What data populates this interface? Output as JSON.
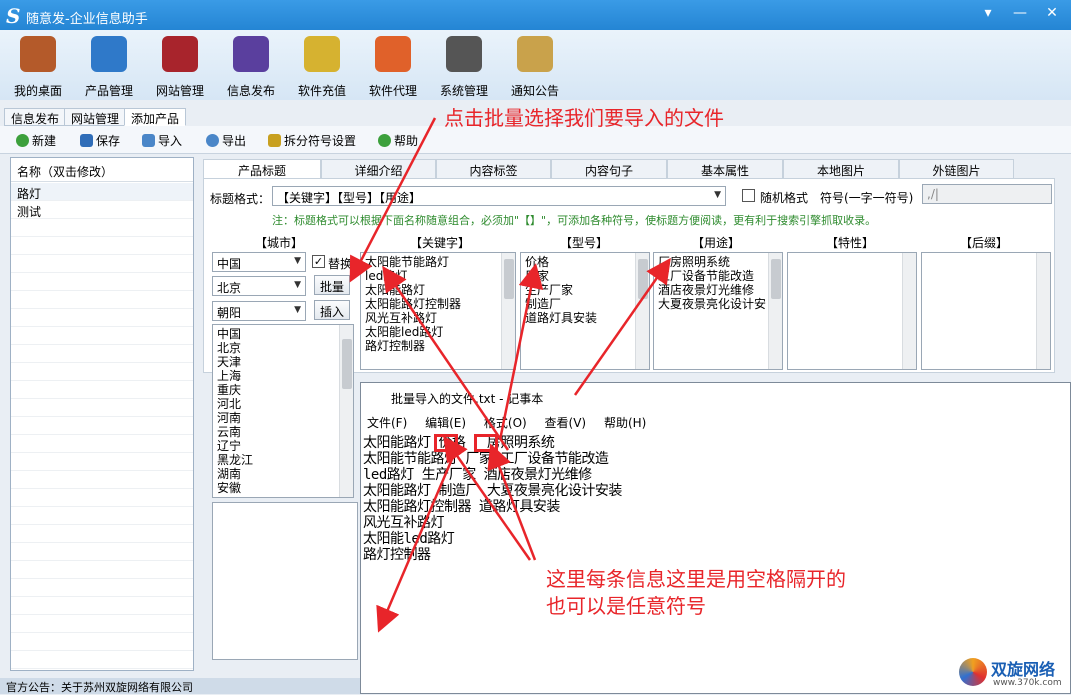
{
  "window": {
    "title": "随意发-企业信息助手",
    "logo": "S",
    "controls": [
      "▾",
      "—",
      "✕"
    ]
  },
  "toolbar": [
    {
      "label": "我的桌面",
      "icon": "house-icon",
      "color": "#b45a2a"
    },
    {
      "label": "产品管理",
      "icon": "cloud-drive-icon",
      "color": "#2f79c9"
    },
    {
      "label": "网站管理",
      "icon": "factory-icon",
      "color": "#a8242c"
    },
    {
      "label": "信息发布",
      "icon": "magic-wand-icon",
      "color": "#5a3f9e"
    },
    {
      "label": "软件充值",
      "icon": "bar-chart-icon",
      "color": "#d6b230"
    },
    {
      "label": "软件代理",
      "icon": "gift-icon",
      "color": "#e0612a"
    },
    {
      "label": "系统管理",
      "icon": "gear-icon",
      "color": "#555555"
    },
    {
      "label": "通知公告",
      "icon": "notepad-icon",
      "color": "#c9a24b"
    }
  ],
  "tabs": [
    "信息发布",
    "网站管理",
    "添加产品"
  ],
  "subtoolbar": [
    {
      "label": "新建",
      "color": "#3ca03c"
    },
    {
      "label": "保存",
      "color": "#2f6db8"
    },
    {
      "label": "导入",
      "color": "#4a86c8"
    },
    {
      "label": "导出",
      "color": "#4a86c8"
    },
    {
      "label": "拆分符号设置",
      "color": "#c8a020"
    },
    {
      "label": "帮助",
      "color": "#3ca03c"
    }
  ],
  "leftpanel": {
    "header": "名称（双击修改）",
    "rows": [
      "路灯",
      "测试"
    ]
  },
  "status": "官方公告：关于苏州双旋网络有限公司",
  "product_tabs": [
    "产品标题",
    "详细介绍",
    "内容标签",
    "内容句子",
    "基本属性",
    "本地图片",
    "外链图片"
  ],
  "form": {
    "title_format_label": "标题格式：",
    "title_format_value": "【关键字】【型号】【用途】",
    "random_label": "随机格式",
    "symbol_label": "符号(一字一符号)",
    "symbol_value": ",/|",
    "note": "注：标题格式可以根据下面名称随意组合，必须加\"【】\"，可添加各种符号，使标题方便阅读，更有利于搜索引擎抓取收录。",
    "columns": [
      "【城市】",
      "【关键字】",
      "【型号】",
      "【用途】",
      "【特性】",
      "【后缀】"
    ],
    "city": {
      "province": "中国",
      "city": "北京",
      "district": "朝阳",
      "replace_label": "替换",
      "batch_button": "批量",
      "insert_button": "插入",
      "list": [
        "中国",
        "北京",
        "天津",
        "上海",
        "重庆",
        "河北",
        "河南",
        "云南",
        "辽宁",
        "黑龙江",
        "湖南",
        "安徽"
      ]
    },
    "keywords": [
      "太阳能节能路灯",
      "led路灯",
      "太阳能路灯",
      "太阳能路灯控制器",
      "风光互补路灯",
      "太阳能led路灯",
      "路灯控制器"
    ],
    "models": [
      "价格",
      "厂家",
      "生产厂家",
      "制造厂",
      "道路灯具安装"
    ],
    "uses": [
      "厂房照明系统",
      "工厂设备节能改造",
      "酒店夜景灯光维修",
      "大夏夜景亮化设计安"
    ]
  },
  "notepad": {
    "title": "批量导入的文件.txt - 记事本",
    "menu": [
      "文件(F)",
      "编辑(E)",
      "格式(O)",
      "查看(V)",
      "帮助(H)"
    ],
    "lines": [
      "太阳能路灯 价格 厂房照明系统",
      "太阳能节能路灯 厂家 工厂设备节能改造",
      "led路灯 生产厂家 酒店夜景灯光维修",
      "太阳能路灯 制造厂 大夏夜景亮化设计安装",
      "太阳能路灯控制器 道路灯具安装",
      "风光互补路灯",
      "太阳能led路灯",
      "路灯控制器"
    ]
  },
  "annotations": {
    "top": "点击批量选择我们要导入的文件",
    "bottom_line1": "这里每条信息这里是用空格隔开的",
    "bottom_line2": "也可以是任意符号"
  },
  "watermark": {
    "name": "双旋网络",
    "url": "www.370k.com"
  }
}
